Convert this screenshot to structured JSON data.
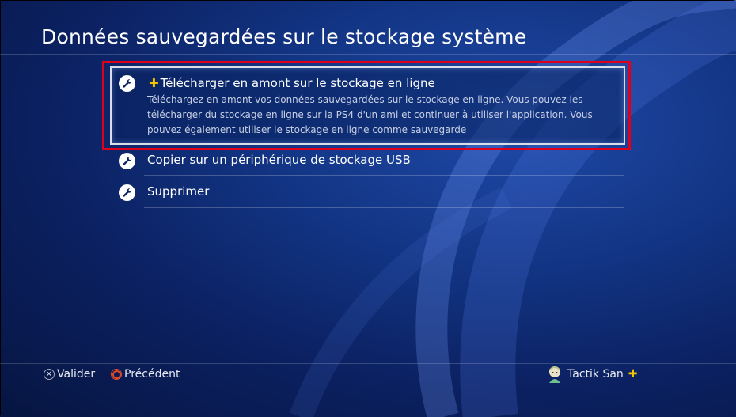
{
  "header": {
    "title": "Données sauvegardées sur le stockage système"
  },
  "menu": {
    "items": [
      {
        "label": "Télécharger en amont sur le stockage en ligne",
        "plus_badge": "✚",
        "description": "Téléchargez en amont vos données sauvegardées sur le stockage en ligne. Vous pouvez les télécharger du stockage en ligne sur la PS4 d'un ami et continuer à utiliser l'application. Vous pouvez également utiliser le stockage en ligne comme sauvegarde",
        "icon": "wrench-icon",
        "selected": true
      },
      {
        "label": "Copier sur un périphérique de stockage USB",
        "icon": "wrench-icon"
      },
      {
        "label": "Supprimer",
        "icon": "wrench-icon"
      }
    ]
  },
  "footer": {
    "confirm": {
      "glyph": "✕",
      "label": "Valider",
      "icon": "cross-button-icon"
    },
    "back": {
      "glyph": "○",
      "label": "Précédent",
      "icon": "circle-button-icon"
    },
    "user": {
      "name": "Tactik San",
      "plus_badge": "✚",
      "icon": "avatar"
    }
  },
  "colors": {
    "highlight_border": "#e0001b",
    "plus_gold": "#f5c400",
    "background": "#0b2060"
  }
}
